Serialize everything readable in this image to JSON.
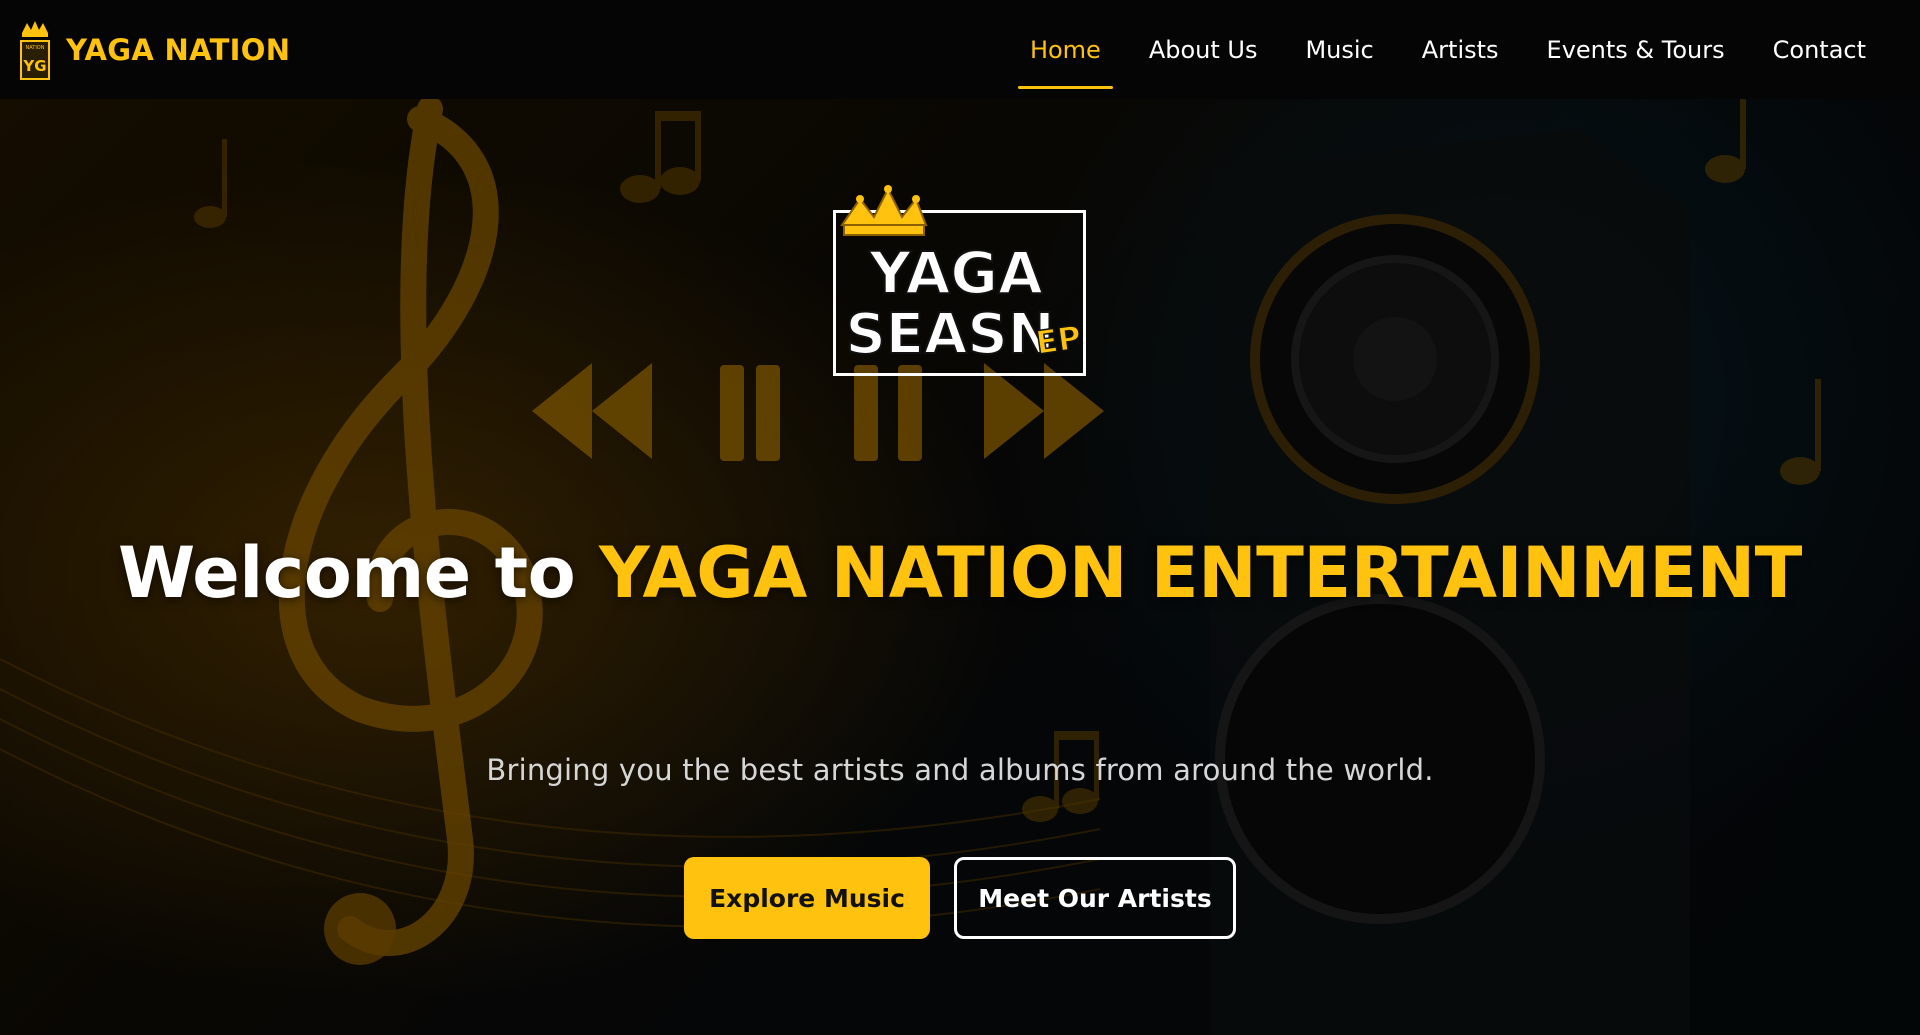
{
  "brand": {
    "name": "YAGA NATION",
    "logo_icon": "crown-yg-logo-icon",
    "logo_text_top": "NATION",
    "logo_text_bottom": "YG"
  },
  "nav": {
    "items": [
      {
        "label": "Home",
        "active": true
      },
      {
        "label": "About Us",
        "active": false
      },
      {
        "label": "Music",
        "active": false
      },
      {
        "label": "Artists",
        "active": false
      },
      {
        "label": "Events & Tours",
        "active": false
      },
      {
        "label": "Contact",
        "active": false
      }
    ]
  },
  "hero": {
    "album_logo": {
      "line1": "YAGA",
      "line2": "SEASN",
      "badge": "EP",
      "icon": "crown-icon"
    },
    "title_prefix": "Welcome to ",
    "title_accent": "YAGA NATION ENTERTAINMENT",
    "subtitle": "Bringing you the best artists and albums from around the world.",
    "primary_button": "Explore Music",
    "secondary_button": "Meet Our Artists"
  },
  "colors": {
    "accent": "#ffc20e",
    "nav_background": "#050505",
    "text": "#ffffff"
  }
}
